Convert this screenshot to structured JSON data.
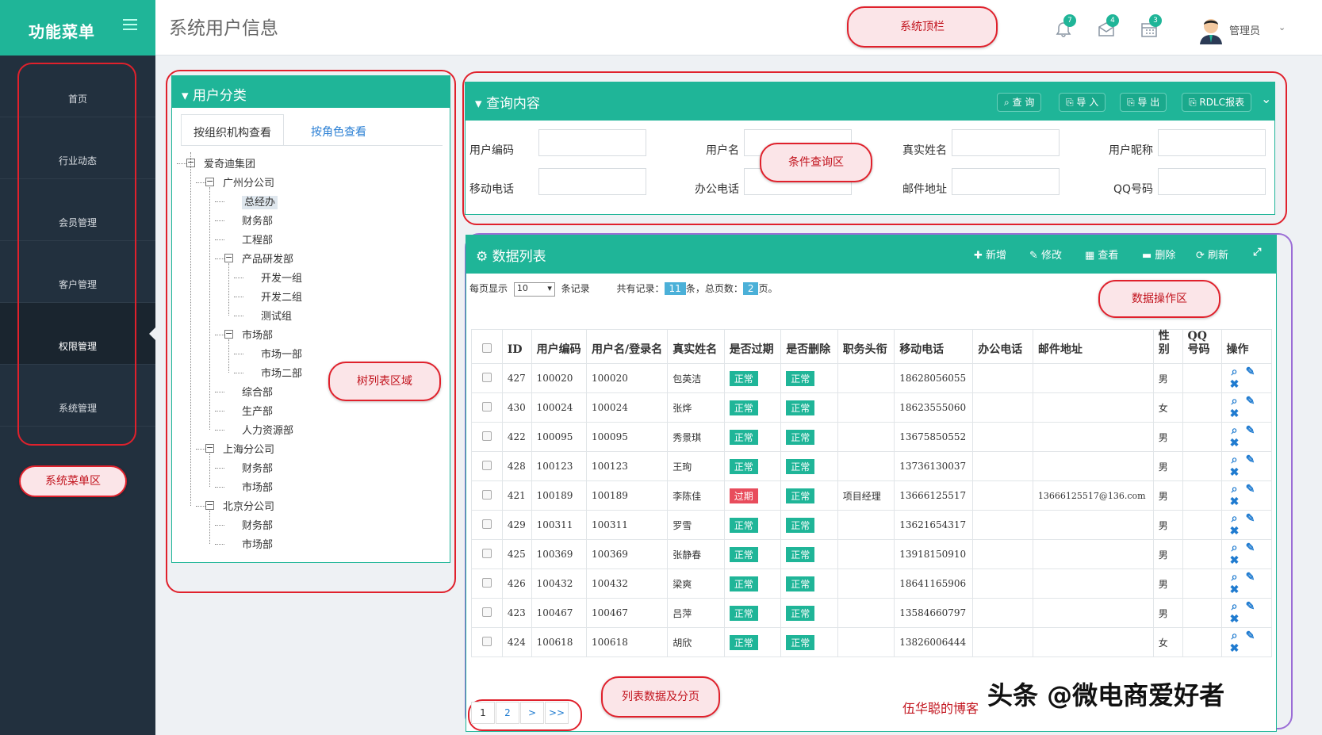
{
  "sidebar": {
    "title": "功能菜单",
    "items": [
      {
        "label": "首页",
        "icon": "home-icon"
      },
      {
        "label": "行业动态",
        "icon": "globe-icon"
      },
      {
        "label": "会员管理",
        "icon": "members-icon"
      },
      {
        "label": "客户管理",
        "icon": "customers-icon"
      },
      {
        "label": "权限管理",
        "icon": "lock-icon",
        "active": true
      },
      {
        "label": "系统管理",
        "icon": "gear-icon"
      }
    ]
  },
  "header": {
    "page_title": "系统用户信息",
    "bell_count": "7",
    "mail_count": "4",
    "cal_count": "3",
    "user": "管理员",
    "dropdown": "⌄"
  },
  "annotations": {
    "top": "系统顶栏",
    "menu": "系统菜单区",
    "tree": "树列表区域",
    "query": "条件查询区",
    "ops": "数据操作区",
    "list": "列表数据及分页"
  },
  "tree_panel": {
    "title": "用户分类",
    "tabs": [
      "按组织机构查看",
      "按角色查看"
    ],
    "nodes": [
      {
        "label": "爱奇迪集团",
        "level": 0,
        "icon": "home"
      },
      {
        "label": "广州分公司",
        "level": 1,
        "icon": "org"
      },
      {
        "label": "总经办",
        "level": 2,
        "icon": "group",
        "selected": true
      },
      {
        "label": "财务部",
        "level": 2,
        "icon": "group"
      },
      {
        "label": "工程部",
        "level": 2,
        "icon": "group"
      },
      {
        "label": "产品研发部",
        "level": 2,
        "icon": "group"
      },
      {
        "label": "开发一组",
        "level": 3,
        "icon": "person"
      },
      {
        "label": "开发二组",
        "level": 3,
        "icon": "person"
      },
      {
        "label": "测试组",
        "level": 3,
        "icon": "person"
      },
      {
        "label": "市场部",
        "level": 2,
        "icon": "group"
      },
      {
        "label": "市场一部",
        "level": 3,
        "icon": "person"
      },
      {
        "label": "市场二部",
        "level": 3,
        "icon": "person"
      },
      {
        "label": "综合部",
        "level": 2,
        "icon": "group"
      },
      {
        "label": "生产部",
        "level": 2,
        "icon": "group"
      },
      {
        "label": "人力资源部",
        "level": 2,
        "icon": "group"
      },
      {
        "label": "上海分公司",
        "level": 1,
        "icon": "org"
      },
      {
        "label": "财务部",
        "level": 2,
        "icon": "group"
      },
      {
        "label": "市场部",
        "level": 2,
        "icon": "group"
      },
      {
        "label": "北京分公司",
        "level": 1,
        "icon": "org"
      },
      {
        "label": "财务部",
        "level": 2,
        "icon": "group"
      },
      {
        "label": "市场部",
        "level": 2,
        "icon": "group"
      }
    ]
  },
  "query": {
    "title": "查询内容",
    "buttons": [
      "查 询",
      "导 入",
      "导 出",
      "RDLC报表"
    ],
    "fields": [
      [
        "用户编码",
        "用户名",
        "真实姓名",
        "用户昵称"
      ],
      [
        "移动电话",
        "办公电话",
        "邮件地址",
        "QQ号码"
      ]
    ]
  },
  "list": {
    "title": "数据列表",
    "actions": [
      "新增",
      "修改",
      "查看",
      "删除",
      "刷新"
    ],
    "page_size_label": "每页显示",
    "page_size": "10",
    "records_label": "条记录",
    "total_label": "共有记录：",
    "total": "11",
    "total_unit": "条，总页数：",
    "pages": "2",
    "pages_unit": "页。",
    "columns": [
      "ID",
      "用户编码",
      "用户名/登录名",
      "真实姓名",
      "是否过期",
      "是否删除",
      "职务头衔",
      "移动电话",
      "办公电话",
      "邮件地址",
      "性别",
      "QQ号码",
      "操作"
    ],
    "rows": [
      [
        "427",
        "100020",
        "100020",
        "包英洁",
        "正常",
        "正常",
        "",
        "18628056055",
        "",
        "",
        "男",
        ""
      ],
      [
        "430",
        "100024",
        "100024",
        "张烨",
        "正常",
        "正常",
        "",
        "18623555060",
        "",
        "",
        "女",
        ""
      ],
      [
        "422",
        "100095",
        "100095",
        "秀景琪",
        "正常",
        "正常",
        "",
        "13675850552",
        "",
        "",
        "男",
        ""
      ],
      [
        "428",
        "100123",
        "100123",
        "王珣",
        "正常",
        "正常",
        "",
        "13736130037",
        "",
        "",
        "男",
        ""
      ],
      [
        "421",
        "100189",
        "100189",
        "李陈佳",
        "过期",
        "正常",
        "项目经理",
        "13666125517",
        "",
        "13666125517@136.com",
        "男",
        ""
      ],
      [
        "429",
        "100311",
        "100311",
        "罗雪",
        "正常",
        "正常",
        "",
        "13621654317",
        "",
        "",
        "男",
        ""
      ],
      [
        "425",
        "100369",
        "100369",
        "张静春",
        "正常",
        "正常",
        "",
        "13918150910",
        "",
        "",
        "男",
        ""
      ],
      [
        "426",
        "100432",
        "100432",
        "梁爽",
        "正常",
        "正常",
        "",
        "18641165906",
        "",
        "",
        "男",
        ""
      ],
      [
        "423",
        "100467",
        "100467",
        "吕萍",
        "正常",
        "正常",
        "",
        "13584660797",
        "",
        "",
        "男",
        ""
      ],
      [
        "424",
        "100618",
        "100618",
        "胡欣",
        "正常",
        "正常",
        "",
        "13826006444",
        "",
        "",
        "女",
        ""
      ]
    ],
    "pager": [
      "1",
      "2",
      ">",
      ">>"
    ]
  },
  "watermark": {
    "blog": "伍华聪的博客",
    "toutiao": "头条 @微电商爱好者"
  }
}
